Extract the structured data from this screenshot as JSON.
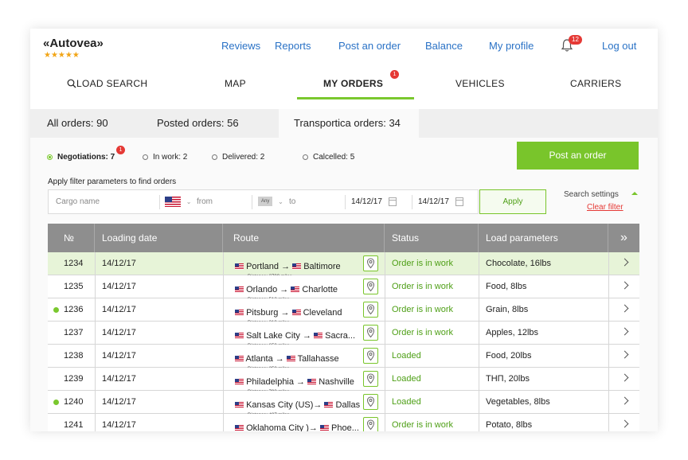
{
  "header": {
    "logo": "«Autovea»",
    "stars": "★★★★★",
    "nav": [
      "Reviews",
      "Reports",
      "Post an order",
      "Balance",
      "My profile"
    ],
    "notifications": "12",
    "logout": "Log out"
  },
  "main_nav": {
    "search": "LOAD SEARCH",
    "map": "MAP",
    "my_orders": "MY ORDERS",
    "my_orders_badge": "1",
    "vehicles": "VEHICLES",
    "carriers": "CARRIERS"
  },
  "subtabs": {
    "all": "All orders: 90",
    "posted": "Posted orders: 56",
    "transportica": "Transportica orders: 34"
  },
  "filters": {
    "negotiations": "Negotiations: 7",
    "negotiations_badge": "1",
    "in_work": "In work: 2",
    "delivered": "Delivered: 2",
    "cancelled": "Calcelled: 5",
    "post_button": "Post an order",
    "hint": "Apply filter parameters to find orders",
    "cargo_placeholder": "Cargo name",
    "from_placeholder": "from",
    "any": "Any",
    "to_placeholder": "to",
    "date_from": "14/12/17",
    "date_to": "14/12/17",
    "apply": "Apply",
    "search_settings": "Search settings",
    "clear_filter": "Clear filter"
  },
  "table": {
    "headers": [
      "№",
      "Loading date",
      "Route",
      "Status",
      "Load parameters"
    ],
    "rows": [
      {
        "no": "1234",
        "date": "14/12/17",
        "route": "Portland → ",
        "to": "Baltimore",
        "dist": "Distance: 2799 miles",
        "status": "Order is in work",
        "params": "Chocolate, 16lbs",
        "highlight": true,
        "dot": false
      },
      {
        "no": "1235",
        "date": "14/12/17",
        "route": "Orlando → ",
        "to": "Charlotte",
        "dist": "Distance: 512 miles",
        "status": "Order is in work",
        "params": "Food, 8lbs",
        "highlight": false,
        "dot": false
      },
      {
        "no": "1236",
        "date": "14/12/17",
        "route": "Pitsburg → ",
        "to": "Cleveland",
        "dist": "Distance: 210 miles",
        "status": "Order is in work",
        "params": "Grain, 8lbs",
        "highlight": false,
        "dot": true
      },
      {
        "no": "1237",
        "date": "14/12/17",
        "route": "Salt Lake City → ",
        "to": "Sacra...",
        "dist": "Distance: 650 miles",
        "status": "Order is in work",
        "params": "Apples, 12lbs",
        "highlight": false,
        "dot": false
      },
      {
        "no": "1238",
        "date": "14/12/17",
        "route": "Atlanta → ",
        "to": "Tallahasse",
        "dist": "Distance: 258 miles",
        "status": "Loaded",
        "params": "Food, 20lbs",
        "highlight": false,
        "dot": false
      },
      {
        "no": "1239",
        "date": "14/12/17",
        "route": "Philadelphia → ",
        "to": "Nashville",
        "dist": "Distance: 793 miles",
        "status": "Loaded",
        "params": "ТНП, 20lbs",
        "highlight": false,
        "dot": false
      },
      {
        "no": "1240",
        "date": "14/12/17",
        "route": "Kansas City (US)→ ",
        "to": "Dallas",
        "dist": "Distance: 487 miles",
        "status": "Loaded",
        "params": "Vegetables, 8lbs",
        "highlight": false,
        "dot": true
      },
      {
        "no": "1241",
        "date": "14/12/17",
        "route": "Oklahoma City )→ ",
        "to": "Phoe...",
        "dist": "Distance: 957 miles",
        "status": "Order is in work",
        "params": "Potato, 8lbs",
        "highlight": false,
        "dot": false
      }
    ]
  }
}
